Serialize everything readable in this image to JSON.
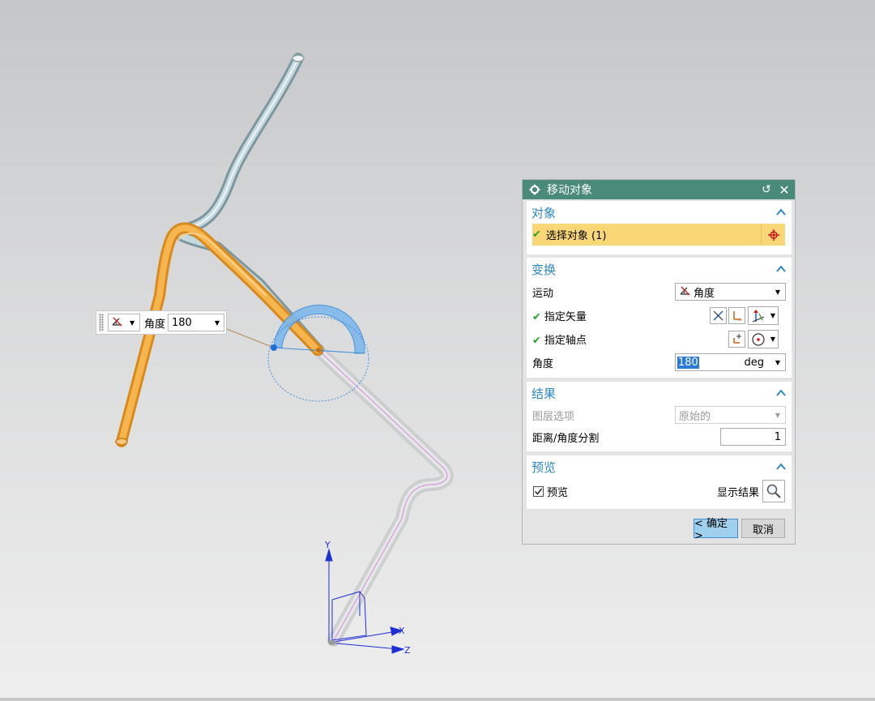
{
  "viewport": {
    "axis_labels": {
      "y": "Y",
      "x": "X",
      "z": "Z"
    }
  },
  "on_screen_input": {
    "motion_icon": "angle-motion-icon",
    "label": "角度",
    "value": "180"
  },
  "dialog": {
    "title": "移动对象",
    "object_group": {
      "title": "对象",
      "select_label": "选择对象 (1)"
    },
    "transform_group": {
      "title": "变换",
      "motion_label": "运动",
      "motion_value": "角度",
      "vector_label": "指定矢量",
      "pivot_label": "指定轴点",
      "angle_label": "角度",
      "angle_value": "180",
      "angle_unit": "deg"
    },
    "result_group": {
      "title": "结果",
      "layer_label": "图层选项",
      "layer_value": "原始的",
      "distance_label": "距离/角度分割",
      "distance_value": "1"
    },
    "preview_group": {
      "title": "预览",
      "preview_label": "预览",
      "preview_checked": true,
      "show_result_label": "显示结果"
    },
    "ok_label": "< 确定 >",
    "cancel_label": "取消"
  },
  "colors": {
    "title_bar": "#4a8a7b",
    "group_title": "#2e88c4",
    "selection_highlight": "#f9d777",
    "orange_tube": "#f0a43a",
    "blue_tube": "#a9c4cc",
    "ok_button": "#9fd0ee"
  }
}
